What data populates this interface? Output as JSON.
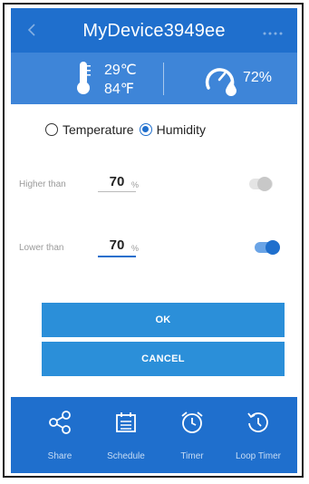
{
  "header": {
    "title": "MyDevice3949ee",
    "back_icon": "chevron-left-icon",
    "more_icon": "more-dots-icon"
  },
  "sensors": {
    "temperature_c": "29℃",
    "temperature_f": "84℉",
    "humidity": "72%"
  },
  "mode": {
    "options": [
      "Temperature",
      "Humidity"
    ],
    "selected": "Humidity"
  },
  "thresholds": {
    "higher": {
      "label": "Higher than",
      "value": "70",
      "unit": "%",
      "enabled": false
    },
    "lower": {
      "label": "Lower than",
      "value": "70",
      "unit": "%",
      "enabled": true
    }
  },
  "buttons": {
    "ok": "OK",
    "cancel": "CANCEL"
  },
  "bottom_nav": [
    {
      "label": "Share",
      "icon": "share-icon"
    },
    {
      "label": "Schedule",
      "icon": "calendar-icon"
    },
    {
      "label": "Timer",
      "icon": "alarm-clock-icon"
    },
    {
      "label": "Loop Timer",
      "icon": "loop-timer-icon"
    }
  ],
  "colors": {
    "primary": "#1f6fcd",
    "panel": "#3e85d8",
    "button": "#2b8fd9"
  }
}
